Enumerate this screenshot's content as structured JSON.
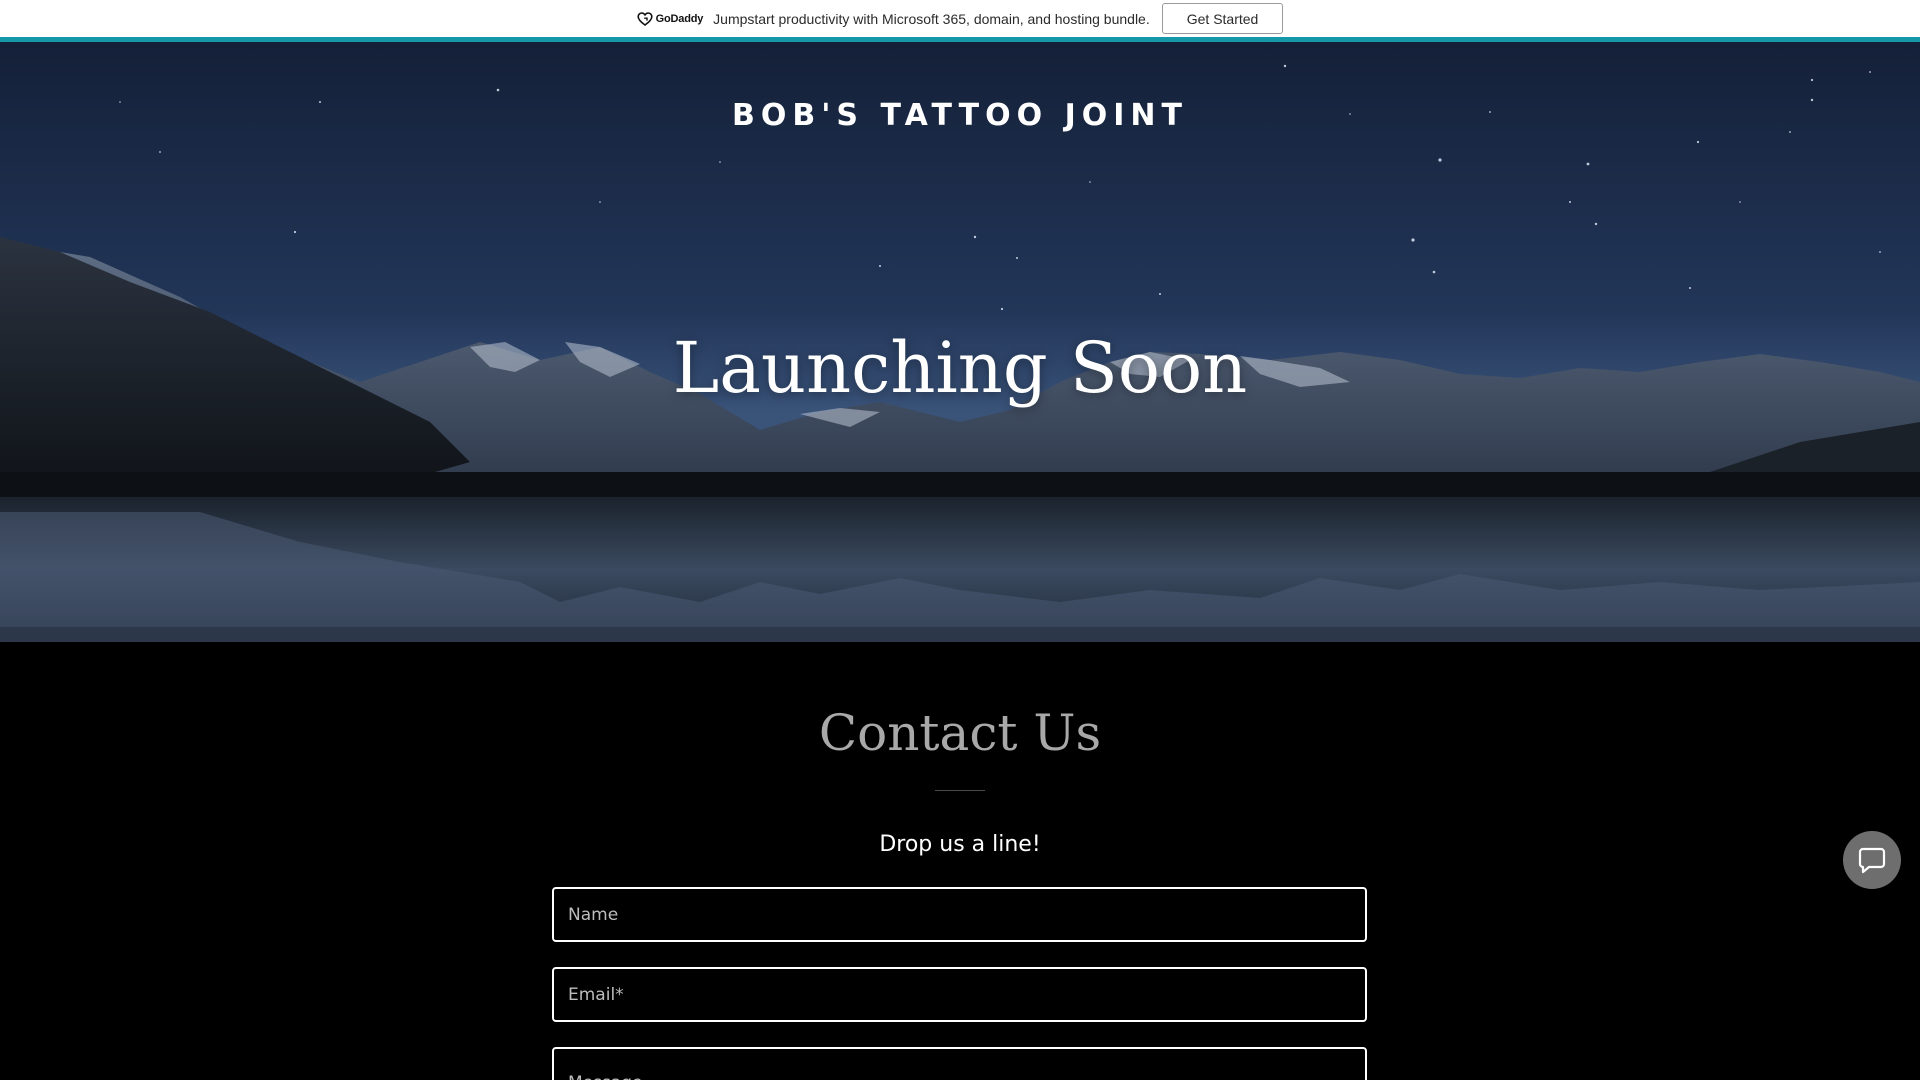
{
  "promo": {
    "logo_text": "GoDaddy",
    "message": "Jumpstart productivity with Microsoft 365, domain, and hosting bundle.",
    "cta_label": "Get Started",
    "accent_color": "#1598a8"
  },
  "hero": {
    "site_title": "BOB'S TATTOO JOINT",
    "heading": "Launching Soon"
  },
  "contact": {
    "heading": "Contact Us",
    "subheading": "Drop us a line!",
    "fields": {
      "name_placeholder": "Name",
      "email_placeholder": "Email*",
      "message_placeholder": "Message"
    }
  },
  "chat": {
    "icon": "chat-bubble-icon"
  }
}
